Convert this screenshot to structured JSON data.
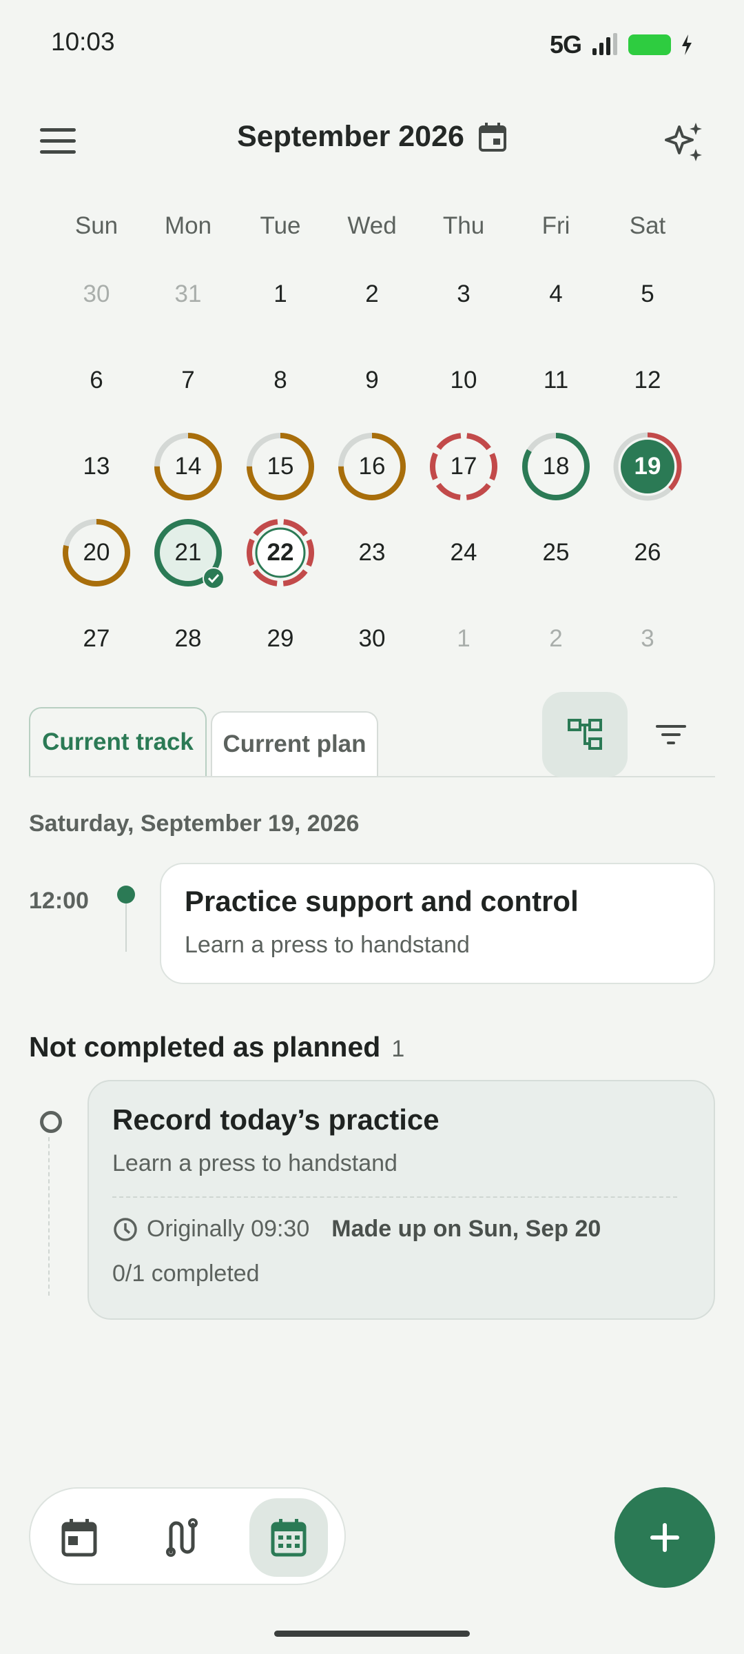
{
  "status_bar": {
    "time": "10:03",
    "network": "5G"
  },
  "header": {
    "title": "September 2026"
  },
  "calendar": {
    "weekdays": [
      "Sun",
      "Mon",
      "Tue",
      "Wed",
      "Thu",
      "Fri",
      "Sat"
    ],
    "weeks": [
      [
        "30",
        "31",
        "1",
        "2",
        "3",
        "4",
        "5"
      ],
      [
        "6",
        "7",
        "8",
        "9",
        "10",
        "11",
        "12"
      ],
      [
        "13",
        "14",
        "15",
        "16",
        "17",
        "18",
        "19"
      ],
      [
        "20",
        "21",
        "22",
        "23",
        "24",
        "25",
        "26"
      ],
      [
        "27",
        "28",
        "29",
        "30",
        "1",
        "2",
        "3"
      ]
    ],
    "selected_day": "19",
    "today": "22",
    "completed_day": "21"
  },
  "tabs": [
    {
      "label": "Current track"
    },
    {
      "label": "Current plan"
    }
  ],
  "schedule": {
    "date": "Saturday, September 19, 2026",
    "time": "12:00",
    "title": "Practice support and control",
    "subtitle": "Learn a press to handstand"
  },
  "not_completed": {
    "heading": "Not completed as planned",
    "count": "1",
    "title": "Record today’s practice",
    "subtitle": "Learn a press to handstand",
    "originally": "Originally 09:30",
    "made_up": "Made up on Sun, Sep 20",
    "progress": "0/1 completed"
  },
  "colors": {
    "accent": "#2b7a55",
    "orange": "#a86e0b",
    "red": "#c24a4a",
    "grey": "#d4d8d5"
  }
}
